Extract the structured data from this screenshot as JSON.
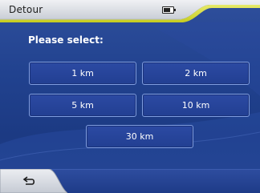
{
  "window": {
    "title": "Detour"
  },
  "status": {
    "icon": "battery-icon"
  },
  "main": {
    "heading": "Please select:",
    "options": [
      "1 km",
      "2 km",
      "5 km",
      "10 km",
      "30 km"
    ]
  },
  "bottom": {
    "back_icon": "back-arrow-icon"
  },
  "colors": {
    "background": "#21428f",
    "title_bar": "#d9dde3",
    "accent": "#d7dc36",
    "button_border": "#7f9de0",
    "text": "#ffffff"
  }
}
